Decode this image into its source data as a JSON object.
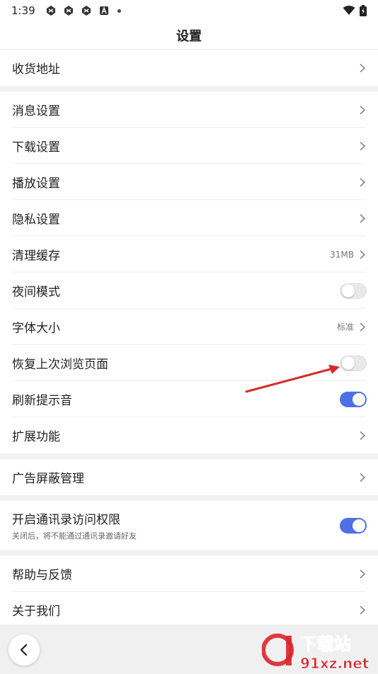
{
  "status_bar": {
    "time": "1:39"
  },
  "header": {
    "title": "设置"
  },
  "sections": {
    "address": {
      "label": "收货地址"
    },
    "message": {
      "label": "消息设置"
    },
    "download": {
      "label": "下载设置"
    },
    "playback": {
      "label": "播放设置"
    },
    "privacy": {
      "label": "隐私设置"
    },
    "cache": {
      "label": "清理缓存",
      "value": "31MB"
    },
    "night_mode": {
      "label": "夜间模式",
      "enabled": false
    },
    "font_size": {
      "label": "字体大小",
      "value": "标准"
    },
    "restore_page": {
      "label": "恢复上次浏览页面",
      "enabled": false
    },
    "refresh_sound": {
      "label": "刷新提示音",
      "enabled": true
    },
    "extensions": {
      "label": "扩展功能"
    },
    "ad_block": {
      "label": "广告屏蔽管理"
    },
    "contacts": {
      "label": "开启通讯录访问权限",
      "sub": "关闭后，将不能通过通讯录邀请好友",
      "enabled": true
    },
    "help": {
      "label": "帮助与反馈"
    },
    "about": {
      "label": "关于我们"
    }
  },
  "watermark": {
    "logo_text": "下载站",
    "url_text": "91xz.net"
  },
  "colors": {
    "accent": "#4e6fe6",
    "divider": "#efefef",
    "section_gap": "#f2f2f2",
    "annotation_arrow": "#d62a2a",
    "watermark_red": "#d9262b"
  },
  "icons": {
    "back": "chevron-left-icon",
    "row_arrow": "chevron-right-icon"
  }
}
